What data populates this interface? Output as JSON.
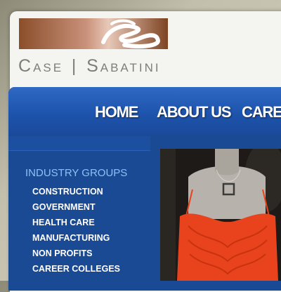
{
  "brand": {
    "name_first": "Case",
    "separator": "|",
    "name_second": "Sabatini",
    "logo_colors": [
      "#8a4e2a",
      "#e8c8b8"
    ]
  },
  "nav": {
    "items": [
      {
        "label": "HOME"
      },
      {
        "label": "ABOUT US"
      },
      {
        "label": "CAREE"
      }
    ]
  },
  "sidebar": {
    "heading": "INDUSTRY GROUPS",
    "items": [
      {
        "label": "CONSTRUCTION"
      },
      {
        "label": "GOVERNMENT"
      },
      {
        "label": "HEALTH CARE"
      },
      {
        "label": "MANUFACTURING"
      },
      {
        "label": "NON PROFITS"
      },
      {
        "label": "CAREER COLLEGES"
      }
    ]
  },
  "colors": {
    "nav_blue": "#1e54ad",
    "sidebar_blue": "#1b4a95",
    "heading_light_blue": "#8ec0f5",
    "dress_orange": "#e8431c"
  },
  "hero": {
    "icon": "mannequin-photo"
  }
}
